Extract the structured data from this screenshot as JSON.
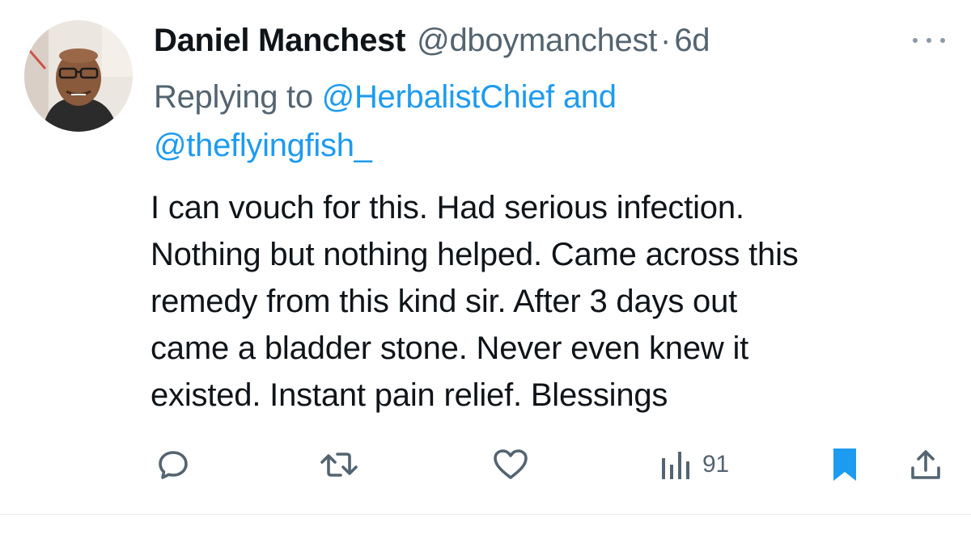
{
  "tweet": {
    "display_name": "Daniel Manchest",
    "handle": "@dboymanchest",
    "separator": "·",
    "time": "6d",
    "replying_prefix": "Replying to",
    "mention_1": "@HerbalistChief",
    "mention_joiner": "and",
    "mention_2": "@theflyingfish_",
    "body_lines": [
      "I can vouch for this. Had serious infection.",
      "Nothing but nothing helped. Came across this",
      "remedy from this kind sir. After 3 days out",
      "came a bladder stone. Never even knew it",
      "existed. Instant pain relief. Blessings"
    ]
  },
  "actions": {
    "reply_icon": "reply-icon",
    "retweet_icon": "retweet-icon",
    "like_icon": "heart-icon",
    "views_icon": "views-icon",
    "views_count": "91",
    "bookmark_icon": "bookmark-icon",
    "share_icon": "share-icon"
  },
  "colors": {
    "accent": "#1d9bf0",
    "secondary_text": "#536471",
    "primary_text": "#0f1419",
    "divider": "#e6e9ec"
  }
}
